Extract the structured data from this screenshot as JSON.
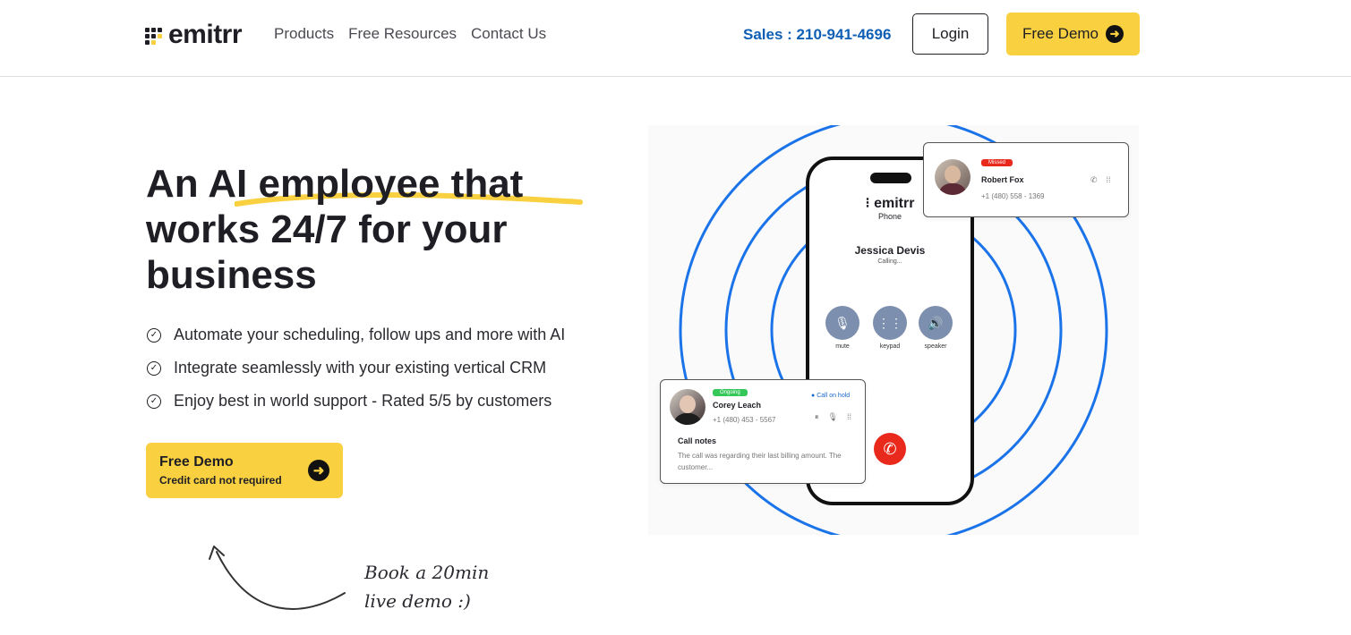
{
  "header": {
    "logo_text": "emitrr",
    "nav": [
      "Products",
      "Free Resources",
      "Contact Us"
    ],
    "sales": "Sales : 210-941-4696",
    "login": "Login",
    "demo": "Free Demo"
  },
  "hero": {
    "title_line1": "An AI employee that",
    "title_line2": "works 24/7 for your",
    "title_line3": "business",
    "bullets": [
      "Automate your scheduling, follow ups and more with AI",
      "Integrate seamlessly with your existing vertical CRM",
      "Enjoy best in world support - Rated 5/5 by customers"
    ],
    "cta_title": "Free Demo",
    "cta_sub": "Credit card not required",
    "handnote_line1": "Book a 20min",
    "handnote_line2": "live demo :)"
  },
  "phone": {
    "logo": "emitrr",
    "app": "Phone",
    "caller": "Jessica Devis",
    "status": "Calling...",
    "controls": [
      "mute",
      "keypad",
      "speaker"
    ]
  },
  "card_top": {
    "badge": "Missed",
    "name": "Robert Fox",
    "number": "+1 (480) 558 - 1369"
  },
  "card_bottom": {
    "badge": "Ongoing",
    "name": "Corey Leach",
    "number": "+1 (480) 453 - 5567",
    "hold": "Call on hold",
    "notes_title": "Call notes",
    "notes_body": "The call was regarding their last billing amount. The customer..."
  },
  "colors": {
    "accent_yellow": "#f9d040",
    "sales_blue": "#0f5fb5",
    "ring_blue": "#1a73e8",
    "missed_red": "#e8291c",
    "ongoing_green": "#35c759"
  }
}
